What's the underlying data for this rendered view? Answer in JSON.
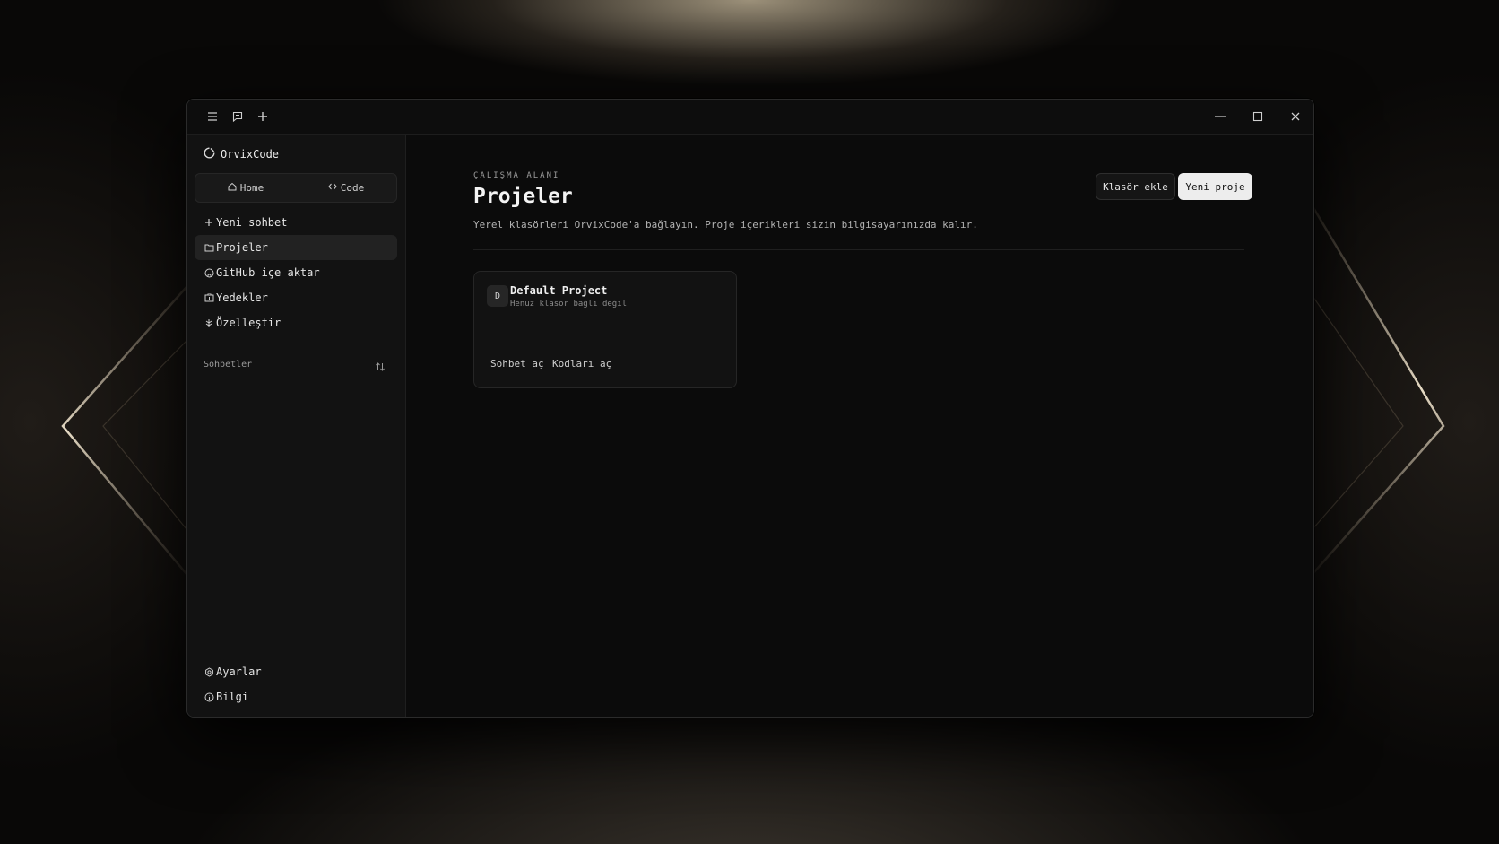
{
  "window": {
    "controls": [
      "minimize-icon",
      "maximize-icon",
      "close-icon"
    ]
  },
  "sidebar": {
    "brand": "OrvixCode",
    "segments": [
      {
        "label": "Home",
        "icon": "home-icon"
      },
      {
        "label": "Code",
        "icon": "code-icon"
      }
    ],
    "items": [
      {
        "label": "Yeni sohbet",
        "icon": "plus-icon"
      },
      {
        "label": "Projeler",
        "icon": "folder-icon",
        "active": true
      },
      {
        "label": "GitHub içe aktar",
        "icon": "github-icon"
      },
      {
        "label": "Yedekler",
        "icon": "backup-icon"
      },
      {
        "label": "Özelleştir",
        "icon": "customize-icon"
      }
    ],
    "section_label": "Sohbetler",
    "footer_items": [
      {
        "label": "Ayarlar",
        "icon": "gear-icon"
      },
      {
        "label": "Bilgi",
        "icon": "info-icon"
      }
    ]
  },
  "main": {
    "eyebrow": "ÇALIŞMA ALANI",
    "title": "Projeler",
    "subtitle": "Yerel klasörleri OrvixCode'a bağlayın. Proje içerikleri sizin bilgisayarınızda kalır.",
    "buttons": {
      "add_folder": "Klasör ekle",
      "new_project": "Yeni proje"
    },
    "projects": [
      {
        "avatar": "D",
        "name": "Default Project",
        "status": "Henüz klasör bağlı değil",
        "actions": [
          "Sohbet aç",
          "Kodları aç"
        ]
      }
    ]
  },
  "colors": {
    "background": "#090807",
    "window": "#0a0a0a",
    "sidebar": "#121212",
    "primary_button": "#ededed",
    "active_item": "#222222"
  }
}
